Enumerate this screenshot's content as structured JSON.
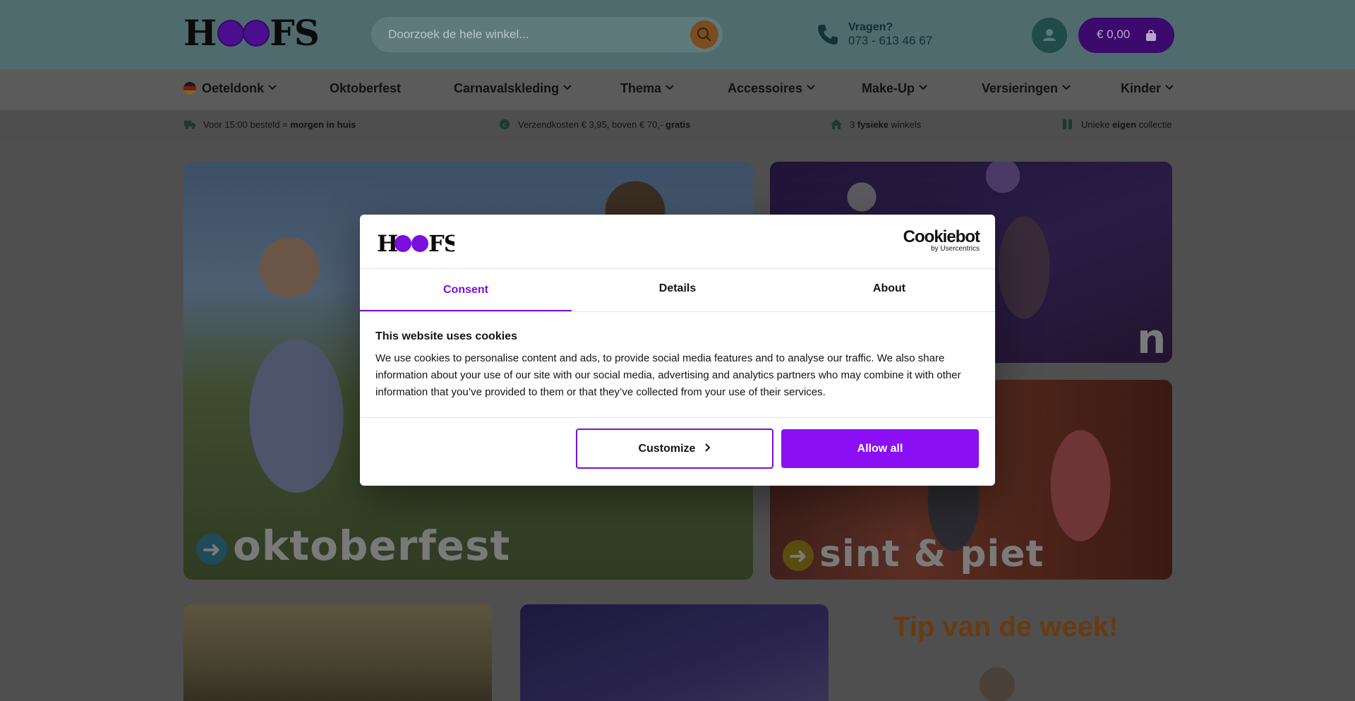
{
  "header": {
    "logo_text": "HOOFS",
    "search": {
      "placeholder": "Doorzoek de hele winkel..."
    },
    "contact": {
      "label": "Vragen?",
      "phone": "073 - 613 46 67"
    },
    "cart": {
      "amount": "€ 0,00"
    }
  },
  "nav": {
    "items": [
      {
        "label": "Oeteldonk",
        "dropdown": true
      },
      {
        "label": "Oktoberfest",
        "dropdown": false
      },
      {
        "label": "Carnavalskleding",
        "dropdown": true
      },
      {
        "label": "Thema",
        "dropdown": true
      },
      {
        "label": "Accessoires",
        "dropdown": true
      },
      {
        "label": "Make-Up",
        "dropdown": true
      },
      {
        "label": "Versieringen",
        "dropdown": true
      },
      {
        "label": "Kinder",
        "dropdown": true
      }
    ]
  },
  "usp": {
    "delivery": {
      "pre": "Voor 15:00 besteld = ",
      "bold": "morgen in huis"
    },
    "shipping": {
      "pre": "Verzendkosten € 3,95, boven € 70,- ",
      "bold": "gratis"
    },
    "stores": {
      "pre": "3 ",
      "bold": "fysieke",
      "post": " winkels"
    },
    "collection": {
      "pre": "Unieke ",
      "bold": "eigen",
      "post": " collectie"
    }
  },
  "banners": {
    "oktoberfest": "oktoberfest",
    "halloween_visible": "n",
    "sint": "sint & piet",
    "tip": "Tip van de week!"
  },
  "cookie_dialog": {
    "logo_text": "HOOFS",
    "brand": "Cookiebot",
    "brand_sub": "by Usercentrics",
    "tabs": [
      "Consent",
      "Details",
      "About"
    ],
    "active_tab": "Consent",
    "title": "This website uses cookies",
    "body": "We use cookies to personalise content and ads, to provide social media features and to analyse our traffic. We also share information about your use of our site with our social media, advertising and analytics partners who may combine it with other information that you’ve provided to them or that they’ve collected from your use of their services.",
    "buttons": {
      "customize": "Customize",
      "allow_all": "Allow all"
    }
  },
  "colors": {
    "accent_purple": "#8a0ff2",
    "cart_purple": "#3b0a6c",
    "tip_orange": "#6a3a10"
  }
}
